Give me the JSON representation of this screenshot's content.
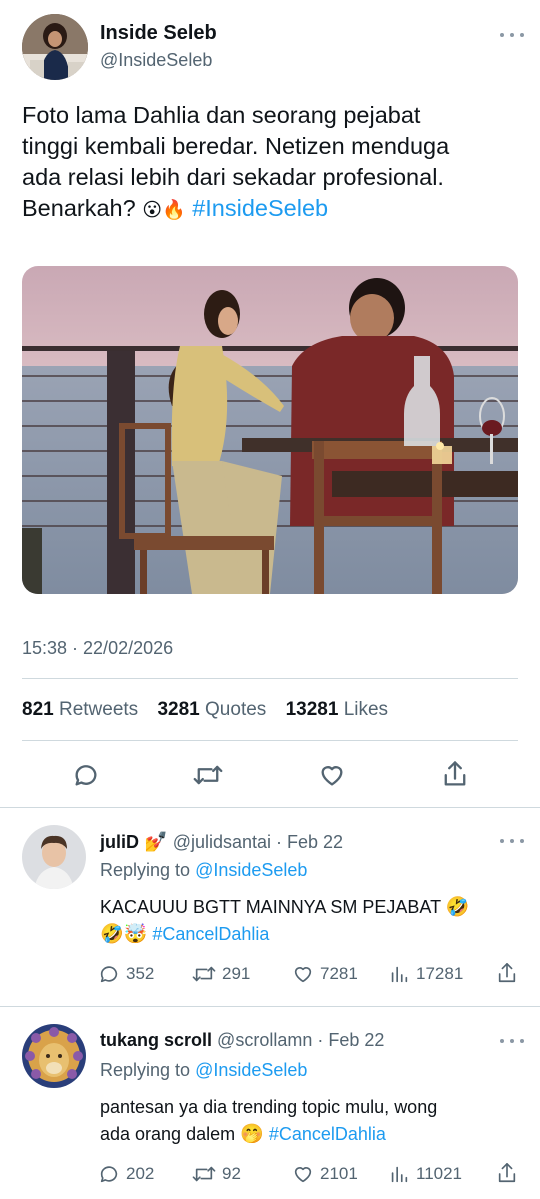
{
  "tweet": {
    "author_name": "Inside Seleb",
    "author_handle": "@InsideSeleb",
    "text_line1": "Foto lama Dahlia dan seorang pejabat",
    "text_line2": "tinggi kembali beredar. Netizen menduga",
    "text_line3": "ada relasi lebih dari sekadar profesional.",
    "text_line4": "Benarkah?",
    "emojis": "😮🔥",
    "hashtag": "#InsideSeleb",
    "timestamp": "15:38 · 22/02/2026",
    "retweets_count": "821",
    "retweets_label": "Retweets",
    "quotes_count": "3281",
    "quotes_label": "Quotes",
    "likes_count": "13281",
    "likes_label": "Likes",
    "actions": [
      "reply-icon",
      "retweet-icon",
      "like-icon",
      "share-icon"
    ]
  },
  "replies": [
    {
      "name": "juliD",
      "name_emoji": "💅",
      "handle_date": "@julidsantai · Feb 22",
      "replying_prefix": "Replying to",
      "replying_to": "@InsideSeleb",
      "text_line1": "KACAUUU BGTT MAINNYA SM PEJABAT",
      "emoji1": "🤣",
      "emoji2": "🤣🤯",
      "hashtag": "#CancelDahlia",
      "reply_count": "352",
      "retweet_count": "291",
      "like_count": "7281",
      "view_count": "17281"
    },
    {
      "name": "tukang scroll",
      "handle_date": "@scrollamn · Feb 22",
      "replying_prefix": "Replying to",
      "replying_to": "@InsideSeleb",
      "text_line1": "pantesan ya dia trending topic mulu, wong",
      "text_line2": "ada orang dalem",
      "emoji": "🤭",
      "hashtag": "#CancelDahlia",
      "reply_count": "202",
      "retweet_count": "92",
      "like_count": "2101",
      "view_count": "11021"
    }
  ],
  "colors": {
    "link": "#1d9bf0",
    "secondary": "#536471",
    "divider": "#cfd9de"
  }
}
